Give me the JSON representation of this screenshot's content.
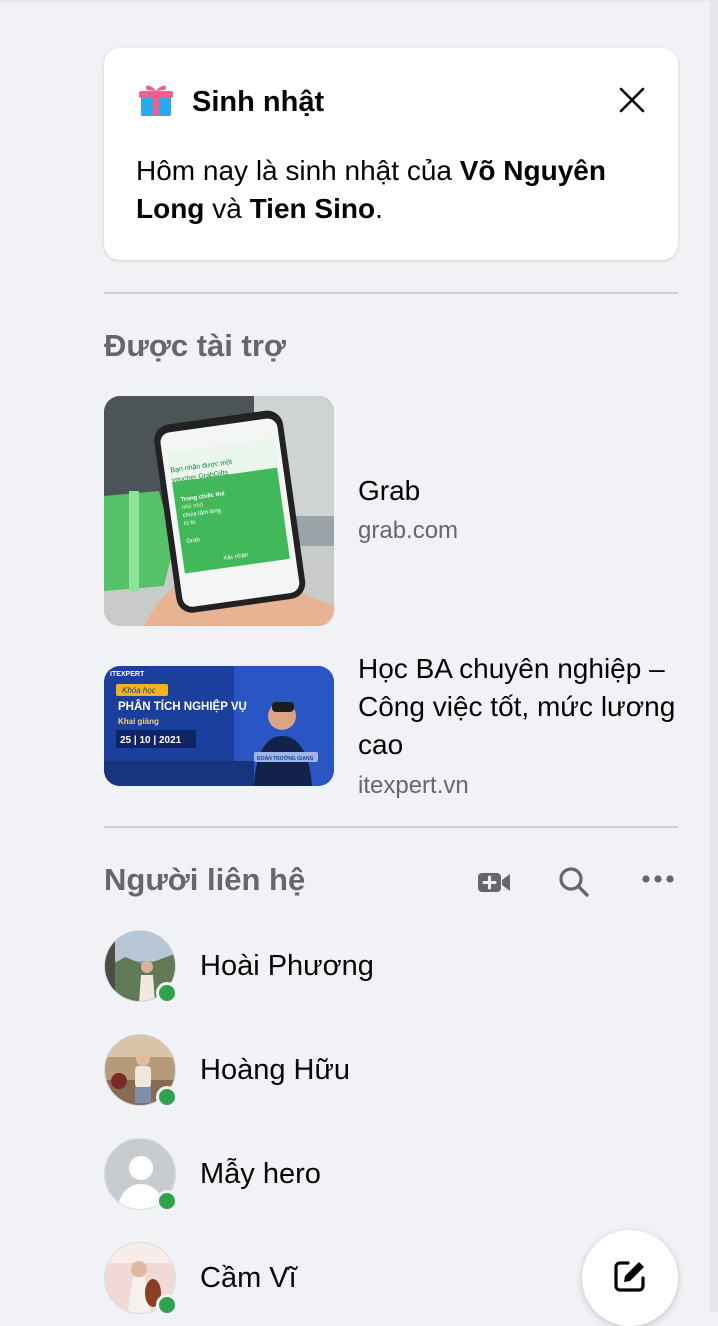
{
  "birthday": {
    "title": "Sinh nhật",
    "text_prefix": "Hôm nay là sinh nhật của ",
    "name_1": "Võ Nguyên Long",
    "connector": " và ",
    "name_2": "Tien Sino",
    "suffix": ".",
    "icon": "gift-icon",
    "close_icon": "close-icon"
  },
  "sponsored": {
    "title": "Được tài trợ",
    "ads": [
      {
        "title": "Grab",
        "domain": "grab.com",
        "image_text": {
          "line1": "Bạn nhận được một",
          "line2": "voucher GrabGifts",
          "line3": "Trong chiếc thẻ",
          "line4": "nhỏ nhỏ",
          "line5": "chứa tấm lòng",
          "line6": "to to",
          "brand": "Grab",
          "button": "Xác nhận"
        }
      },
      {
        "title": "Học BA chuyên nghiệp – Công việc tốt, mức lương cao",
        "domain": "itexpert.vn",
        "image_text": {
          "logo": "ITEXPERT",
          "course_tag": "Khóa học",
          "course_name": "PHÂN TÍCH NGHIỆP VỤ",
          "start": "Khai giảng",
          "date": "25 | 10 | 2021",
          "speaker": "ĐOÀN TRƯỜNG GIANG"
        }
      }
    ]
  },
  "contacts": {
    "title": "Người liên hệ",
    "icons": [
      "new-room-video-icon",
      "search-icon",
      "more-options-icon"
    ],
    "items": [
      {
        "name": "Hoài Phương",
        "online": true
      },
      {
        "name": "Hoàng Hữu",
        "online": true
      },
      {
        "name": "Mẫy hero",
        "online": true
      },
      {
        "name": "Cầm Vĩ",
        "online": true
      }
    ]
  },
  "compose": {
    "icon": "new-message-icon"
  },
  "colors": {
    "background": "#f0f2f5",
    "card": "#ffffff",
    "secondary_text": "#65676b",
    "online": "#31a24c",
    "divider": "#ced0d4"
  }
}
